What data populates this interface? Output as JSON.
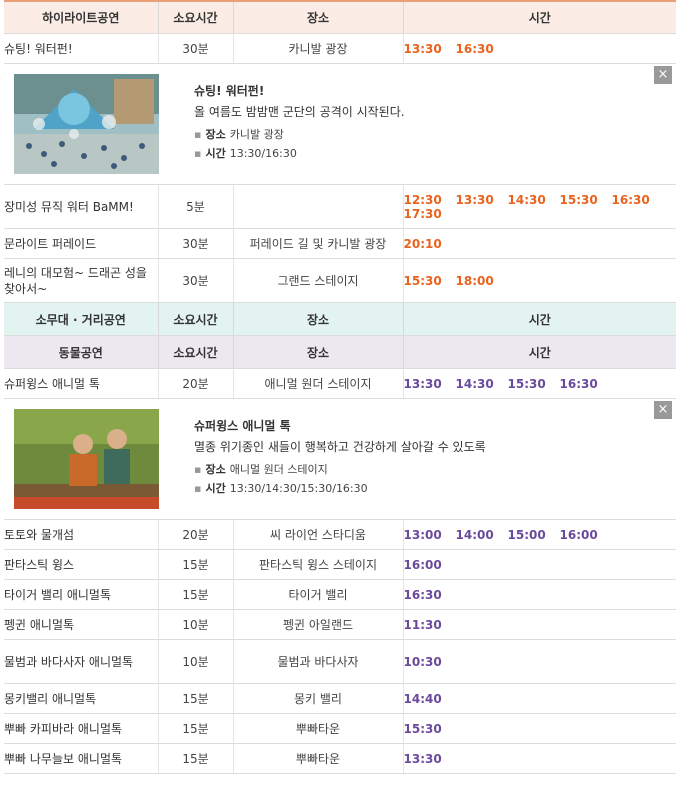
{
  "colors": {
    "orange_time": "#e86320",
    "purple_time": "#6a4a9c"
  },
  "highlight": {
    "headers": [
      "하이라이트공연",
      "소요시간",
      "장소",
      "시간"
    ],
    "rows": [
      {
        "name": "슈팅! 워터펀!",
        "duration": "30분",
        "place": "카니발 광장",
        "times": [
          "13:30",
          "16:30"
        ]
      }
    ],
    "detail": {
      "title": "슈팅! 워터펀!",
      "desc": "올 여름도 밤밤맨 군단의 공격이 시작된다.",
      "place_label": "장소",
      "place": "카니발 광장",
      "time_label": "시간",
      "time": "13:30/16:30",
      "close_icon": "×"
    },
    "rows2": [
      {
        "name": "장미성 뮤직 워터 BaMM!",
        "duration": "5분",
        "place": "",
        "times": [
          "12:30",
          "13:30",
          "14:30",
          "15:30",
          "16:30",
          "17:30"
        ]
      },
      {
        "name": "문라이트 퍼레이드",
        "duration": "30분",
        "place": "퍼레이드 길 및 카니발 광장",
        "times": [
          "20:10"
        ]
      },
      {
        "name": "레니의 대모험~ 드래곤 성을 찾아서~",
        "duration": "30분",
        "place": "그랜드 스테이지",
        "times": [
          "15:30",
          "18:00"
        ]
      }
    ]
  },
  "small_stage": {
    "headers": [
      "소무대 · 거리공연",
      "소요시간",
      "장소",
      "시간"
    ]
  },
  "animal": {
    "headers": [
      "동물공연",
      "소요시간",
      "장소",
      "시간"
    ],
    "rows": [
      {
        "name": "슈퍼윙스 애니멀 톡",
        "duration": "20분",
        "place": "애니멀 원더 스테이지",
        "times": [
          "13:30",
          "14:30",
          "15:30",
          "16:30"
        ]
      }
    ],
    "detail": {
      "title": "슈퍼윙스 애니멀 톡",
      "desc": "멸종 위기종인 새들이 행복하고 건강하게 살아갈 수 있도록",
      "place_label": "장소",
      "place": "애니멀 원더 스테이지",
      "time_label": "시간",
      "time": "13:30/14:30/15:30/16:30",
      "close_icon": "×"
    },
    "rows2": [
      {
        "name": "토토와 물개섬",
        "duration": "20분",
        "place": "씨 라이언 스타디움",
        "times": [
          "13:00",
          "14:00",
          "15:00",
          "16:00"
        ]
      },
      {
        "name": "판타스틱 윙스",
        "duration": "15분",
        "place": "판타스틱 윙스 스테이지",
        "times": [
          "16:00"
        ]
      },
      {
        "name": "타이거 밸리 애니멀톡",
        "duration": "15분",
        "place": "타이거 밸리",
        "times": [
          "16:30"
        ]
      },
      {
        "name": "펭귄 애니멀톡",
        "duration": "10분",
        "place": "펭귄 아일랜드",
        "times": [
          "11:30"
        ]
      },
      {
        "name": "물범과 바다사자 애니멀톡",
        "duration": "10분",
        "place": "물범과 바다사자",
        "times": [
          "10:30"
        ]
      },
      {
        "name": "몽키밸리 애니멀톡",
        "duration": "15분",
        "place": "몽키 밸리",
        "times": [
          "14:40"
        ]
      },
      {
        "name": "뿌빠 카피바라 애니멀톡",
        "duration": "15분",
        "place": "뿌빠타운",
        "times": [
          "15:30"
        ]
      },
      {
        "name": "뿌빠 나무늘보 애니멀톡",
        "duration": "15분",
        "place": "뿌빠타운",
        "times": [
          "13:30"
        ]
      }
    ]
  }
}
